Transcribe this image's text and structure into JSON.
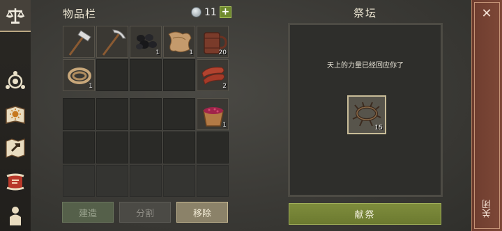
{
  "sidebar": {
    "items": [
      {
        "name": "balance-icon"
      },
      {
        "name": "altar-icon"
      },
      {
        "name": "sun-book-icon"
      },
      {
        "name": "build-map-icon"
      },
      {
        "name": "scroll-icon"
      },
      {
        "name": "character-icon"
      }
    ]
  },
  "inventory": {
    "title": "物品栏",
    "currency": "11",
    "plus_label": "+",
    "slots": [
      {
        "icon": "stone-hammer-icon",
        "count": ""
      },
      {
        "icon": "stone-pickaxe-icon",
        "count": ""
      },
      {
        "icon": "coal-icon",
        "count": "1"
      },
      {
        "icon": "leather-icon",
        "count": "1"
      },
      {
        "icon": "wooden-mug-icon",
        "count": "20"
      },
      {
        "icon": "rope-icon",
        "count": "1"
      },
      {
        "icon": "",
        "count": ""
      },
      {
        "icon": "",
        "count": ""
      },
      {
        "icon": "",
        "count": ""
      },
      {
        "icon": "raw-meat-icon",
        "count": "2"
      },
      {
        "icon": "",
        "count": ""
      },
      {
        "icon": "",
        "count": ""
      },
      {
        "icon": "",
        "count": ""
      },
      {
        "icon": "",
        "count": ""
      },
      {
        "icon": "berry-bowl-icon",
        "count": "1"
      }
    ],
    "buttons": {
      "build": "建造",
      "split": "分割",
      "remove": "移除"
    }
  },
  "altar": {
    "title": "祭坛",
    "message": "天上的力量已经回应你了",
    "slot": {
      "icon": "thorn-crown-icon",
      "count": "15"
    },
    "offer_label": "献祭"
  },
  "close": {
    "label": "关闭"
  }
}
